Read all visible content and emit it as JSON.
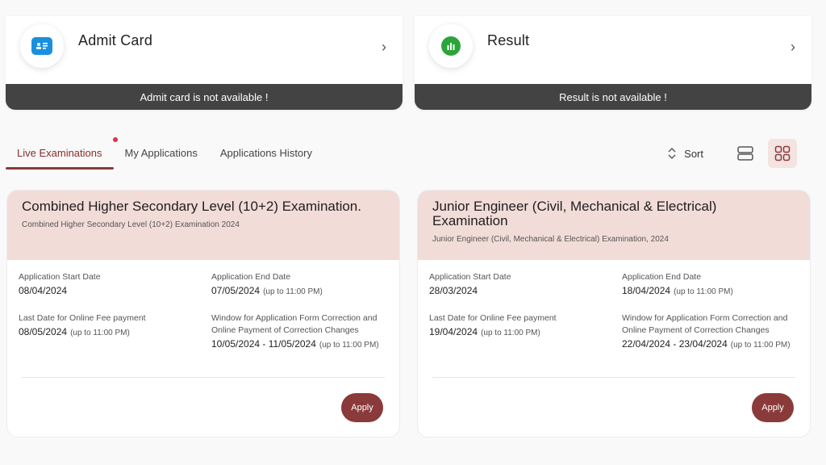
{
  "status_cards": [
    {
      "title": "Admit Card",
      "icon": "id-card-icon",
      "chevron": "›",
      "message": "Admit card is not available !",
      "icon_color": "#1a8fe0"
    },
    {
      "title": "Result",
      "icon": "bar-chart-icon",
      "chevron": "›",
      "message": "Result is not available !",
      "icon_color": "#2aa53a"
    }
  ],
  "tabs": [
    {
      "label": "Live Examinations",
      "active": true
    },
    {
      "label": "My Applications",
      "active": false
    },
    {
      "label": "Applications History",
      "active": false
    }
  ],
  "toolbar": {
    "sort_label": "Sort"
  },
  "exams": [
    {
      "title": "Combined Higher Secondary Level (10+2) Examination.",
      "subtitle": "Combined Higher Secondary Level (10+2) Examination 2024",
      "start_label": "Application Start Date",
      "start_date": "08/04/2024",
      "end_label": "Application End Date",
      "end_date": "07/05/2024",
      "end_note": "(up to 11:00 PM)",
      "fee_label": "Last Date for Online Fee payment",
      "fee_date": "08/05/2024",
      "fee_note": "(up to 11:00 PM)",
      "window_label": "Window for Application Form Correction and Online Payment of Correction Changes",
      "window_dates": "10/05/2024 - 11/05/2024",
      "window_note": "(up to 11:00 PM)",
      "apply_label": "Apply"
    },
    {
      "title": "Junior Engineer (Civil, Mechanical & Electrical) Examination",
      "subtitle": "Junior Engineer (Civil, Mechanical & Electrical) Examination, 2024",
      "start_label": "Application Start Date",
      "start_date": "28/03/2024",
      "end_label": "Application End Date",
      "end_date": "18/04/2024",
      "end_note": "(up to 11:00 PM)",
      "fee_label": "Last Date for Online Fee payment",
      "fee_date": "19/04/2024",
      "fee_note": "(up to 11:00 PM)",
      "window_label": "Window for Application Form Correction and Online Payment of Correction Changes",
      "window_dates": "22/04/2024 - 23/04/2024",
      "window_note": "(up to 11:00 PM)",
      "apply_label": "Apply"
    }
  ],
  "colors": {
    "accent": "#8a3a3a",
    "header_tint": "#f2dcd8",
    "status_bar": "#434343",
    "notification_dot": "#d9364a"
  }
}
